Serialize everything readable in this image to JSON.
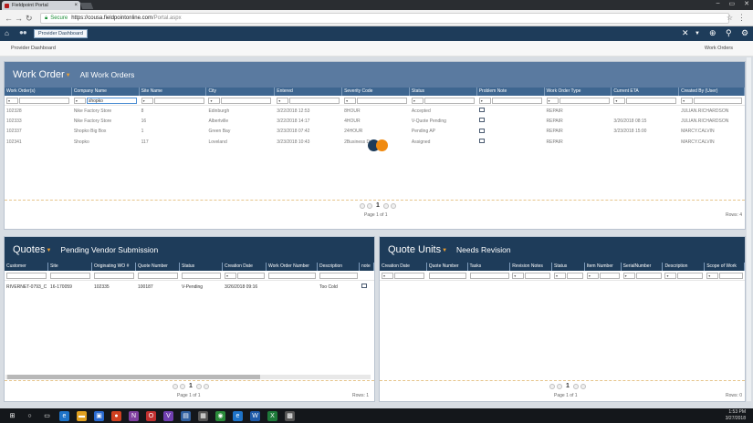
{
  "browser": {
    "tab_title": "Fieldpoint Portal",
    "security_label": "Secure",
    "url_host": "https://cousa.fieldpointonline.com",
    "url_path": "/Portal.aspx"
  },
  "header": {
    "crumb_pill": "Provider Dashboard",
    "left_link": "Provider Dashboard",
    "right_link": "Work Orders"
  },
  "work_orders": {
    "title": "Work Order",
    "subtitle": "All Work Orders",
    "columns": [
      "Work Order(s)",
      "Company Name",
      "Site Name",
      "City",
      "Entered",
      "Severity Code",
      "Status",
      "Problem Note",
      "Work Order Type",
      "Current ETA",
      "Created By (User)"
    ],
    "filter_company": "shopko",
    "rows": [
      [
        "102328",
        "Nike Factory Store",
        "8",
        "Edinburgh",
        "3/22/2018 12:53",
        "8HOUR",
        "Accepted",
        "",
        "REPAIR",
        "",
        "JULIAN.RICHARDSON"
      ],
      [
        "102333",
        "Nike Factory Store",
        "16",
        "Albertville",
        "3/22/2018 14:17",
        "4HOUR",
        "V-Quote Pending",
        "",
        "REPAIR",
        "3/26/2018 08:15",
        "JULIAN.RICHARDSON"
      ],
      [
        "102337",
        "Shopko Big Box",
        "1",
        "Green Bay",
        "3/23/2018 07:42",
        "24HOUR",
        "Pending AP",
        "",
        "REPAIR",
        "3/23/2018 15:00",
        "MARCY.CALVIN"
      ],
      [
        "102341",
        "Shopko",
        "117",
        "Loveland",
        "3/23/2018 10:43",
        "2Business D",
        "Assigned",
        "",
        "REPAIR",
        "",
        "MARCY.CALVIN"
      ]
    ],
    "page_num": "1",
    "page_text": "Page 1 of 1",
    "rows_text": "Rows: 4"
  },
  "quotes": {
    "title": "Quotes",
    "subtitle": "Pending Vendor Submission",
    "columns": [
      "Customer",
      "Site",
      "Originating WO #",
      "Quote Number",
      "Status",
      "Creation Date",
      "Work Order Number",
      "Description",
      "note"
    ],
    "rows": [
      [
        "RIVERNET-0793_C",
        "16-170059",
        "102335",
        "100187",
        "V-Pending",
        "3/26/2018 09:16",
        "",
        "Too Cold",
        ""
      ]
    ],
    "page_num": "1",
    "page_text": "Page 1 of 1",
    "rows_text": "Rows: 1"
  },
  "quote_units": {
    "title": "Quote Units",
    "subtitle": "Needs Revision",
    "columns": [
      "Creation Date",
      "Quote Number",
      "Tasks",
      "Revision Notes",
      "Status",
      "Item Number",
      "SerialNumber",
      "Description",
      "Scope of Work"
    ],
    "page_num": "1",
    "page_text": "Page 1 of 1",
    "rows_text": "Rows: 0"
  },
  "taskbar": {
    "time": "1:53 PM",
    "date": "3/27/2018"
  }
}
